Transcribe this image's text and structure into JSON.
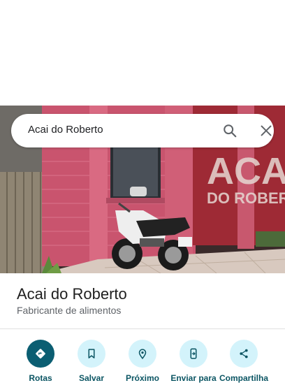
{
  "search": {
    "query": "Acai do Roberto"
  },
  "place": {
    "name": "Acai do Roberto",
    "category": "Fabricante de alimentos"
  },
  "photo": {
    "sign_text_line1": "ACA",
    "sign_text_line2": "DO ROBERT"
  },
  "actions": [
    {
      "label": "Rotas",
      "icon": "directions-icon"
    },
    {
      "label": "Salvar",
      "icon": "bookmark-icon"
    },
    {
      "label": "Próximo",
      "icon": "nearby-icon"
    },
    {
      "label": "Enviar para",
      "icon": "send-to-phone-icon"
    },
    {
      "label": "Compartilha",
      "icon": "share-icon"
    }
  ],
  "colors": {
    "primary_action": "#0b5e72",
    "secondary_action_bg": "#d3f3fb",
    "action_icon": "#0b5563"
  }
}
